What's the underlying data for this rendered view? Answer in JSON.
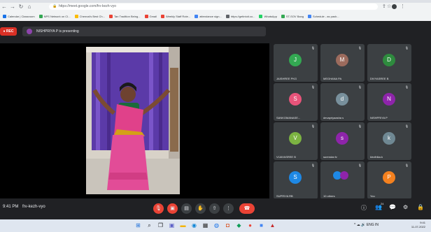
{
  "browser": {
    "url": "https://meet.google.com/frv-kezh-vyo",
    "bookmarks": [
      {
        "label": "Calendar | Classroom",
        "color": "#1a73e8"
      },
      {
        "label": "NPS Network on CI...",
        "color": "#34a853"
      },
      {
        "label": "Chennai's Best Ch...",
        "color": "#fbbc04"
      },
      {
        "label": "Tan Tradition Being...",
        "color": "#ea4335"
      },
      {
        "label": "Gmail",
        "color": "#ea4335"
      },
      {
        "label": "Weekly Staff Rote...",
        "color": "#ea4335"
      },
      {
        "label": "attendance sign...",
        "color": "#4285f4"
      },
      {
        "label": "https://getintoit.co...",
        "color": "#5f6368"
      },
      {
        "label": "WhatsApp",
        "color": "#25d366"
      },
      {
        "label": "ST-SOV Bang",
        "color": "#34a853"
      },
      {
        "label": "Schedule - as pash...",
        "color": "#4285f4"
      }
    ]
  },
  "meet": {
    "rec_label": "REC",
    "presenter_initial": "N",
    "presenting_text": "NISHPRIYA P is presenting",
    "time": "9:41 PM",
    "meeting_code": "frv-kezh-vyo",
    "people_count": "24"
  },
  "participants": [
    {
      "initial": "J",
      "name": "JAISHREE PKG",
      "color": "#33a852"
    },
    {
      "initial": "M",
      "name": "MEGHANA PA",
      "color": "#9c6b5d"
    },
    {
      "initial": "D",
      "name": "DIVYASREE B",
      "color": "#2e8b3e"
    },
    {
      "initial": "S",
      "name": "SANKOMANASE...",
      "color": "#e8547a"
    },
    {
      "initial": "d",
      "name": "devapriyaasha s",
      "color": "#78909c"
    },
    {
      "initial": "N",
      "name": "NISHPRIYA P",
      "color": "#8e24aa"
    },
    {
      "initial": "V",
      "name": "VIJAYASREE B",
      "color": "#7cb342"
    },
    {
      "initial": "s",
      "name": "surendar.fv",
      "color": "#8e24aa"
    },
    {
      "initial": "k",
      "name": "kiruthika.k",
      "color": "#6f8893"
    },
    {
      "initial": "S",
      "name": "SUPRIYA RB",
      "color": "#1e88e5"
    },
    {
      "initial": "",
      "name": "10 others",
      "color": "#3c4043"
    },
    {
      "initial": "P",
      "name": "You",
      "color": "#f4811f"
    }
  ],
  "taskbar": {
    "lang": "ENG IN",
    "clock_time": "9:41",
    "clock_date": "11-07-2022"
  }
}
